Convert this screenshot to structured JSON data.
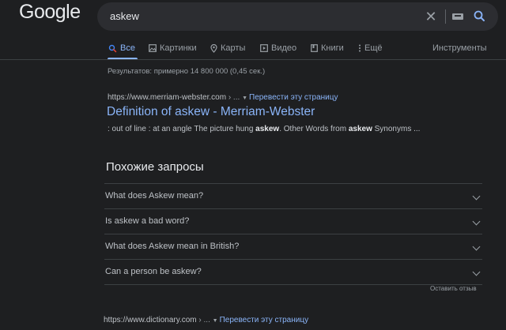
{
  "header": {
    "logo": "Google",
    "search_value": "askew"
  },
  "tabs": [
    {
      "label": "Все",
      "icon": "search-icon",
      "active": true
    },
    {
      "label": "Картинки",
      "icon": "image-icon"
    },
    {
      "label": "Карты",
      "icon": "map-pin-icon"
    },
    {
      "label": "Видео",
      "icon": "play-icon"
    },
    {
      "label": "Книги",
      "icon": "book-icon"
    },
    {
      "label": "Ещё",
      "icon": "more-vert-icon"
    }
  ],
  "tools_label": "Инструменты",
  "result_stats": "Результатов: примерно 14 800 000 (0,45 сек.)",
  "results": [
    {
      "cite": "https://www.merriam-webster.com",
      "cite_suffix": " › ...",
      "translate": "Перевести эту страницу",
      "title": "Definition of askew - Merriam-Webster",
      "snippet": [
        {
          "t": ": out of line : at an angle The picture hung ",
          "b": false
        },
        {
          "t": "askew",
          "b": true
        },
        {
          "t": ". Other Words from ",
          "b": false
        },
        {
          "t": "askew",
          "b": true
        },
        {
          "t": " Synonyms ...",
          "b": false
        }
      ]
    },
    {
      "cite": "https://www.dictionary.com",
      "cite_suffix": " › ...",
      "translate": "Перевести эту страницу"
    }
  ],
  "related": {
    "heading": "Похожие запросы",
    "items": [
      "What does Askew mean?",
      "Is askew a bad word?",
      "What does Askew mean in British?",
      "Can a person be askew?"
    ],
    "feedback": "Оставить отзыв"
  },
  "colors": {
    "background": "#1e1f21",
    "link": "#8ab4f8",
    "accent": "#4285f4"
  }
}
